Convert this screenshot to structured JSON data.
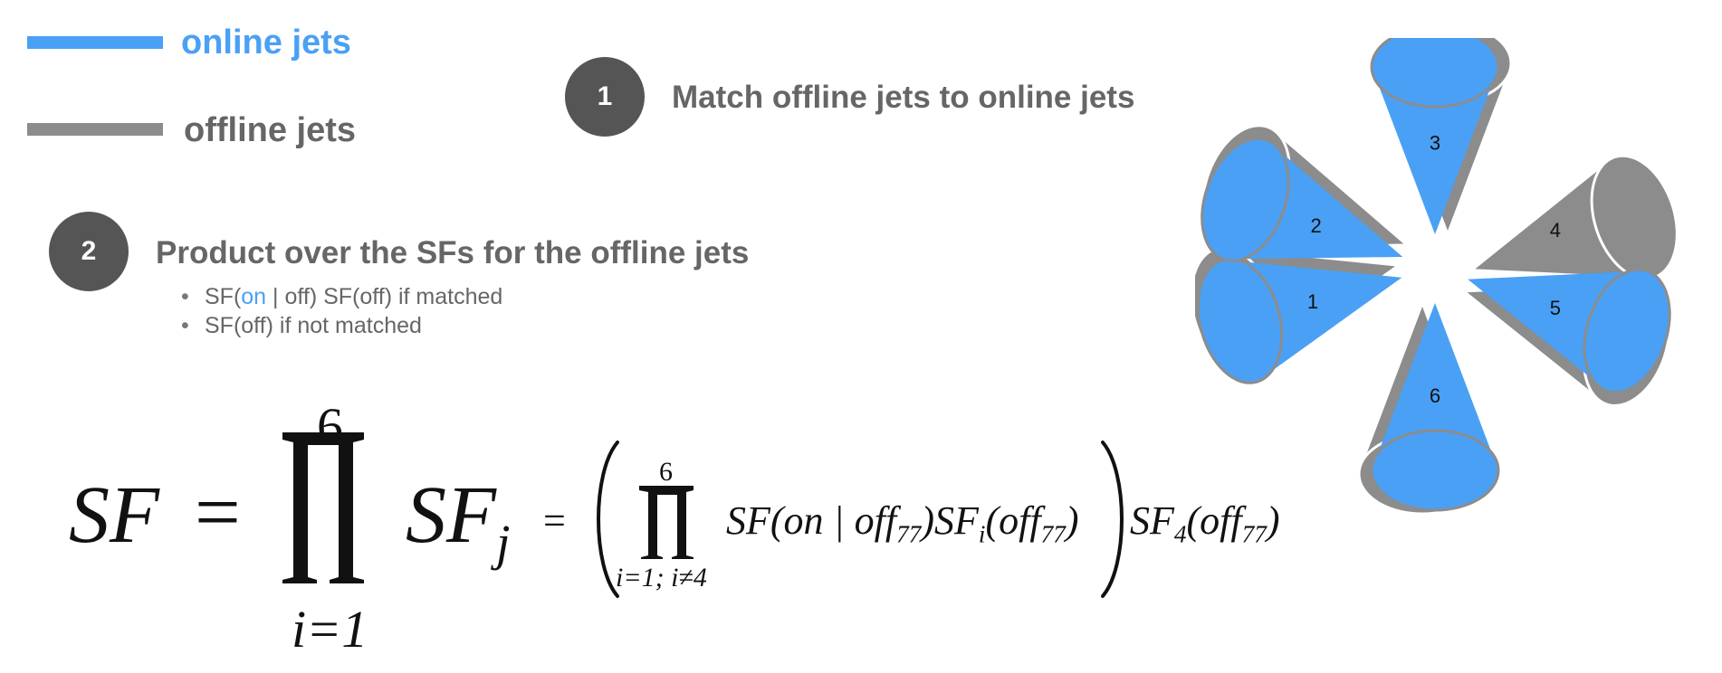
{
  "legend": {
    "online_label": "online jets",
    "offline_label": "offline jets"
  },
  "steps": [
    {
      "number": "1",
      "text": "Match offline jets to online jets"
    },
    {
      "number": "2",
      "text": "Product over the SFs for the offline jets"
    }
  ],
  "bullets": {
    "b1_prefix": "SF(",
    "b1_on": "on",
    "b1_suffix": " | off) SF(off) if matched",
    "b2": "SF(off) if not matched"
  },
  "formula": {
    "lhs": "SF",
    "equals": "=",
    "product_symbol": "∏",
    "upper_limit": "6",
    "lower_limit": "i=1",
    "summand": "SF",
    "summand_sub": "j",
    "equals2": "=",
    "inner_upper": "6",
    "inner_lower": "i=1; i≠4",
    "inner_term_a": "SF(on | off",
    "inner_sub_a": "77",
    "inner_term_b": ")SF",
    "inner_sub_i": "i",
    "inner_term_c": "(off",
    "inner_sub_c": "77",
    "inner_term_d": ")",
    "tail_a": "SF",
    "tail_sub": "4",
    "tail_b": "(off",
    "tail_sub2": "77",
    "tail_c": ")"
  },
  "jets": [
    {
      "label": "1",
      "state": "matched"
    },
    {
      "label": "2",
      "state": "matched"
    },
    {
      "label": "3",
      "state": "matched"
    },
    {
      "label": "4",
      "state": "unmatched"
    },
    {
      "label": "5",
      "state": "matched"
    },
    {
      "label": "6",
      "state": "matched"
    }
  ],
  "colors": {
    "online": "#4aa0f5",
    "offline": "#8c8c8c",
    "step_circle": "#555555",
    "text_gray": "#666666"
  }
}
